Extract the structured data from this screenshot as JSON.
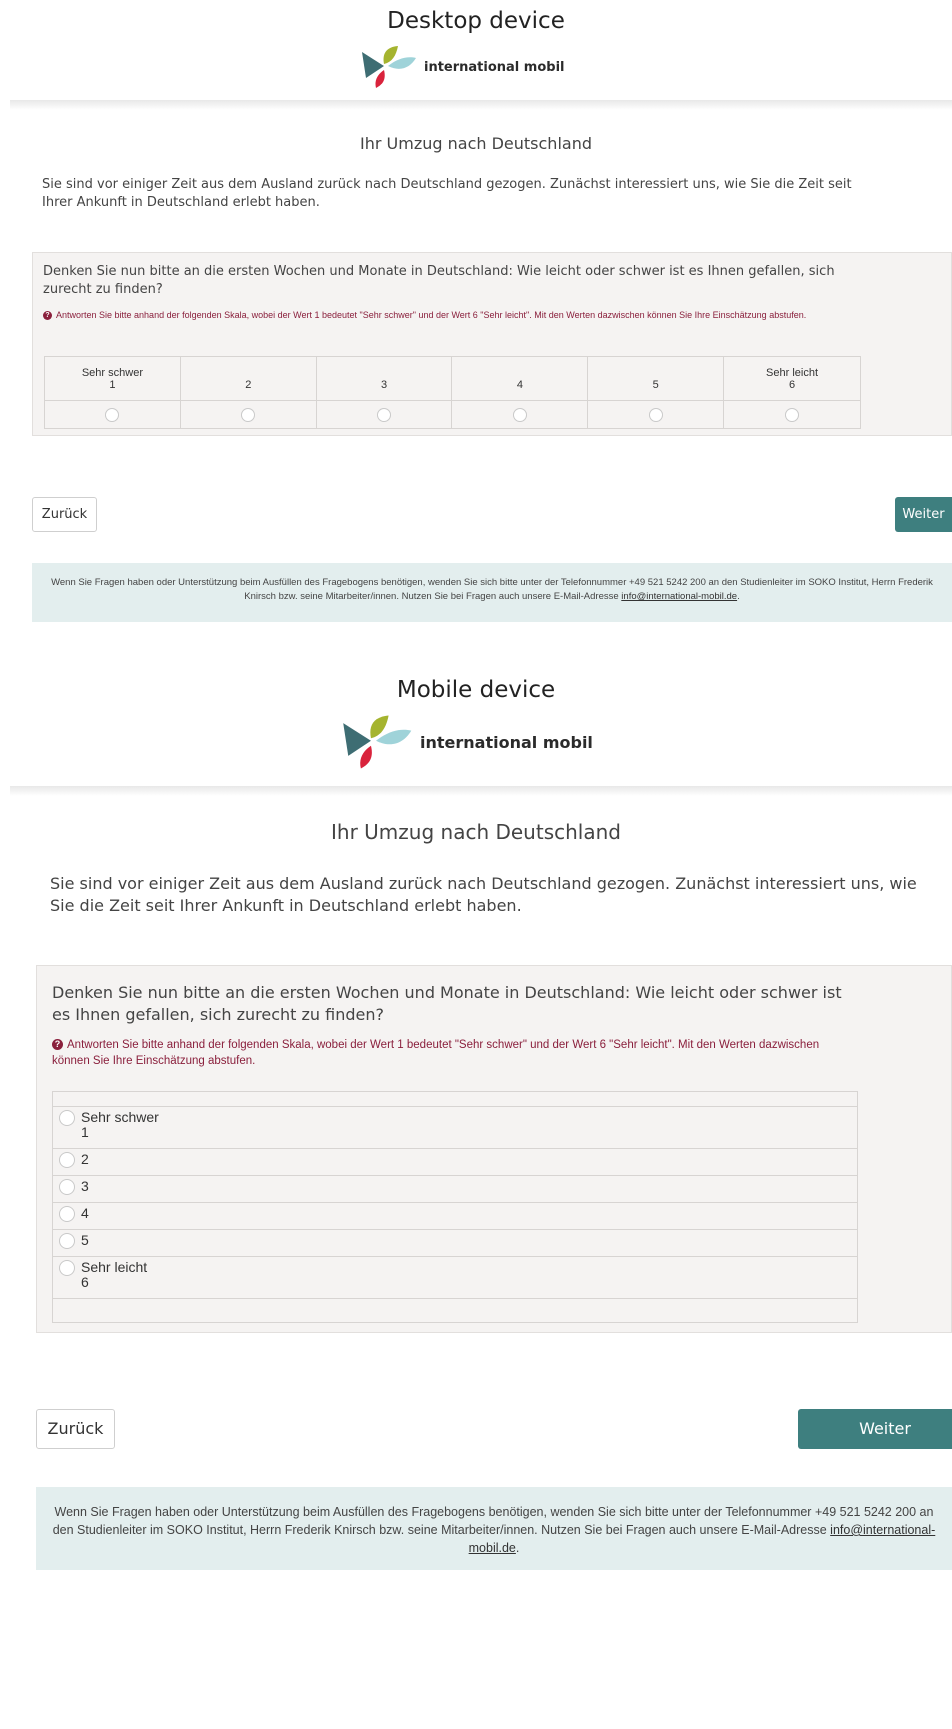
{
  "labels": {
    "desktop": "Desktop device",
    "mobile": "Mobile device"
  },
  "brand": {
    "name": "international mobil",
    "colors": {
      "teal": "#3e6d73",
      "green": "#a5b42f",
      "lightblue": "#9fd3d9",
      "red": "#d9233c"
    }
  },
  "survey": {
    "title": "Ihr Umzug nach Deutschland",
    "intro": "Sie sind vor einiger Zeit aus dem Ausland zurück nach Deutschland gezogen. Zunächst interessiert uns, wie Sie die Zeit seit Ihrer Ankunft in Deutschland erlebt haben.",
    "question": "Denken Sie nun bitte an die ersten Wochen und Monate in Deutschland: Wie leicht oder schwer ist es Ihnen gefallen, sich zurecht zu finden?",
    "hint": "Antworten Sie bitte anhand der folgenden Skala, wobei der Wert 1 bedeutet \"Sehr schwer\" und der Wert 6 \"Sehr leicht\". Mit den Werten dazwischen können Sie Ihre Einschätzung abstufen.",
    "hint_icon": "?",
    "options": [
      {
        "label": "Sehr schwer",
        "value": "1"
      },
      {
        "label": "",
        "value": "2"
      },
      {
        "label": "",
        "value": "3"
      },
      {
        "label": "",
        "value": "4"
      },
      {
        "label": "",
        "value": "5"
      },
      {
        "label": "Sehr leicht",
        "value": "6"
      }
    ],
    "back": "Zurück",
    "next": "Weiter"
  },
  "footer": {
    "text": "Wenn Sie Fragen haben oder Unterstützung beim Ausfüllen des Fragebogens benötigen, wenden Sie sich bitte unter der Telefonnummer +49 521 5242 200 an den Studienleiter im SOKO Institut, Herrn Frederik Knirsch bzw. seine Mitarbeiter/innen. Nutzen Sie bei Fragen auch unsere E-Mail-Adresse",
    "email": "info@international-mobil.de",
    "end": "."
  }
}
